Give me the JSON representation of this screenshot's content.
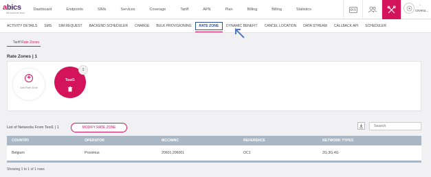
{
  "brand": {
    "logo_main": "abics",
    "logo_tag": "We build ice tech"
  },
  "main_nav": [
    "Dashboard",
    "Endpoints",
    "SIMs",
    "Services",
    "Coverage",
    "Tariff",
    "APN",
    "Plan",
    "Billing",
    "Billing",
    "Statistics"
  ],
  "user": {
    "name": "covera...",
    "help": "?"
  },
  "sub_nav": [
    "ACTIVITY DETAILS",
    "SMS",
    "SIM REQUEST",
    "BACKEND SCHEDULER",
    "CHARGE",
    "BULK PROVISIONING",
    "RATE ZONE",
    "DYNAMIC BENEFIT",
    "CANCEL LOCATION",
    "DATA STREAM",
    "CALLBACK API",
    "SCHEDULER"
  ],
  "active_sub_tab": "RATE ZONE",
  "breadcrumb": {
    "parent": "Tariff",
    "current": "Rate Zones"
  },
  "rate_zones": {
    "title": "Rate Zones",
    "count": "1",
    "add_label": "Add Rate Zone",
    "zones": [
      {
        "name": "Test1",
        "badge": "1"
      }
    ]
  },
  "networks": {
    "label": "List of Networks From Test1",
    "count": "1",
    "modify_button": "MODIFY RATE ZONE",
    "search_placeholder": "Search",
    "columns": [
      "COUNTRY",
      "OPERATOR",
      "MCC/MNC",
      "REFERENCE",
      "NETWORK TYPES"
    ],
    "rows": [
      [
        "Belgium",
        "Proximus",
        "20601,206001",
        "OC1",
        "2G,3G,4G"
      ]
    ],
    "footer": "Showing 1 to 1 of 1 rows"
  },
  "colors": {
    "accent": "#d4145a",
    "table_header": "#a9b6c3",
    "active_tab_border": "#2a4d9a"
  }
}
